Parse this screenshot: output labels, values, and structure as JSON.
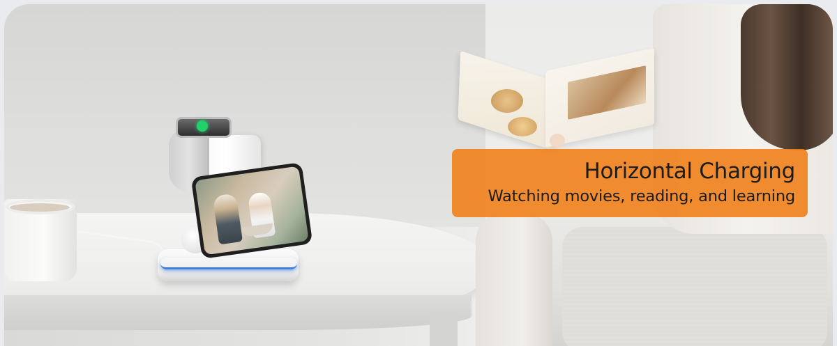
{
  "banner": {
    "title": "Horizontal Charging",
    "subtitle": "Watching movies, reading, and learning",
    "background_color": "#f0821e",
    "text_color": "#1c1c1c"
  },
  "scene": {
    "accent_led_color": "#3c7bd8",
    "watch_icon_color": "#22d16b"
  }
}
